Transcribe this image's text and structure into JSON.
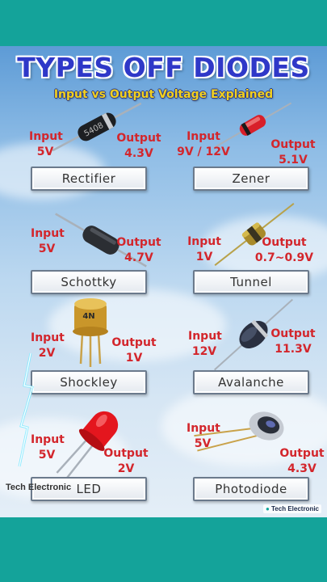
{
  "title": "TYPES OFF DIODES",
  "subtitle": "Input vs Output Voltage Explained",
  "diodes": [
    {
      "name": "Rectifier",
      "input_label": "Input",
      "input_value": "5V",
      "output_label": "Output",
      "output_value": "4.3V",
      "marking": "5408"
    },
    {
      "name": "Zener",
      "input_label": "Input",
      "input_value": "9V / 12V",
      "output_label": "Output",
      "output_value": "5.1V"
    },
    {
      "name": "Schottky",
      "input_label": "Input",
      "input_value": "5V",
      "output_label": "Output",
      "output_value": "4.7V"
    },
    {
      "name": "Tunnel",
      "input_label": "Input",
      "input_value": "1V",
      "output_label": "Output",
      "output_value": "0.7~0.9V"
    },
    {
      "name": "Shockley",
      "input_label": "Input",
      "input_value": "2V",
      "output_label": "Output",
      "output_value": "1V",
      "marking": "4N"
    },
    {
      "name": "Avalanche",
      "input_label": "Input",
      "input_value": "12V",
      "output_label": "Output",
      "output_value": "11.3V"
    },
    {
      "name": "LED",
      "input_label": "Input",
      "input_value": "5V",
      "output_label": "Output",
      "output_value": "2V"
    },
    {
      "name": "Photodiode",
      "input_label": "Input",
      "input_value": "5V",
      "output_label": "Output",
      "output_value": "4.3V"
    }
  ],
  "watermark": "Tech Electronic",
  "brand": "Tech Electronic",
  "colors": {
    "frame": "#14a39a",
    "title": "#2f38c8",
    "subtitle": "#f2d01e",
    "voltage_text": "#d3262c"
  }
}
